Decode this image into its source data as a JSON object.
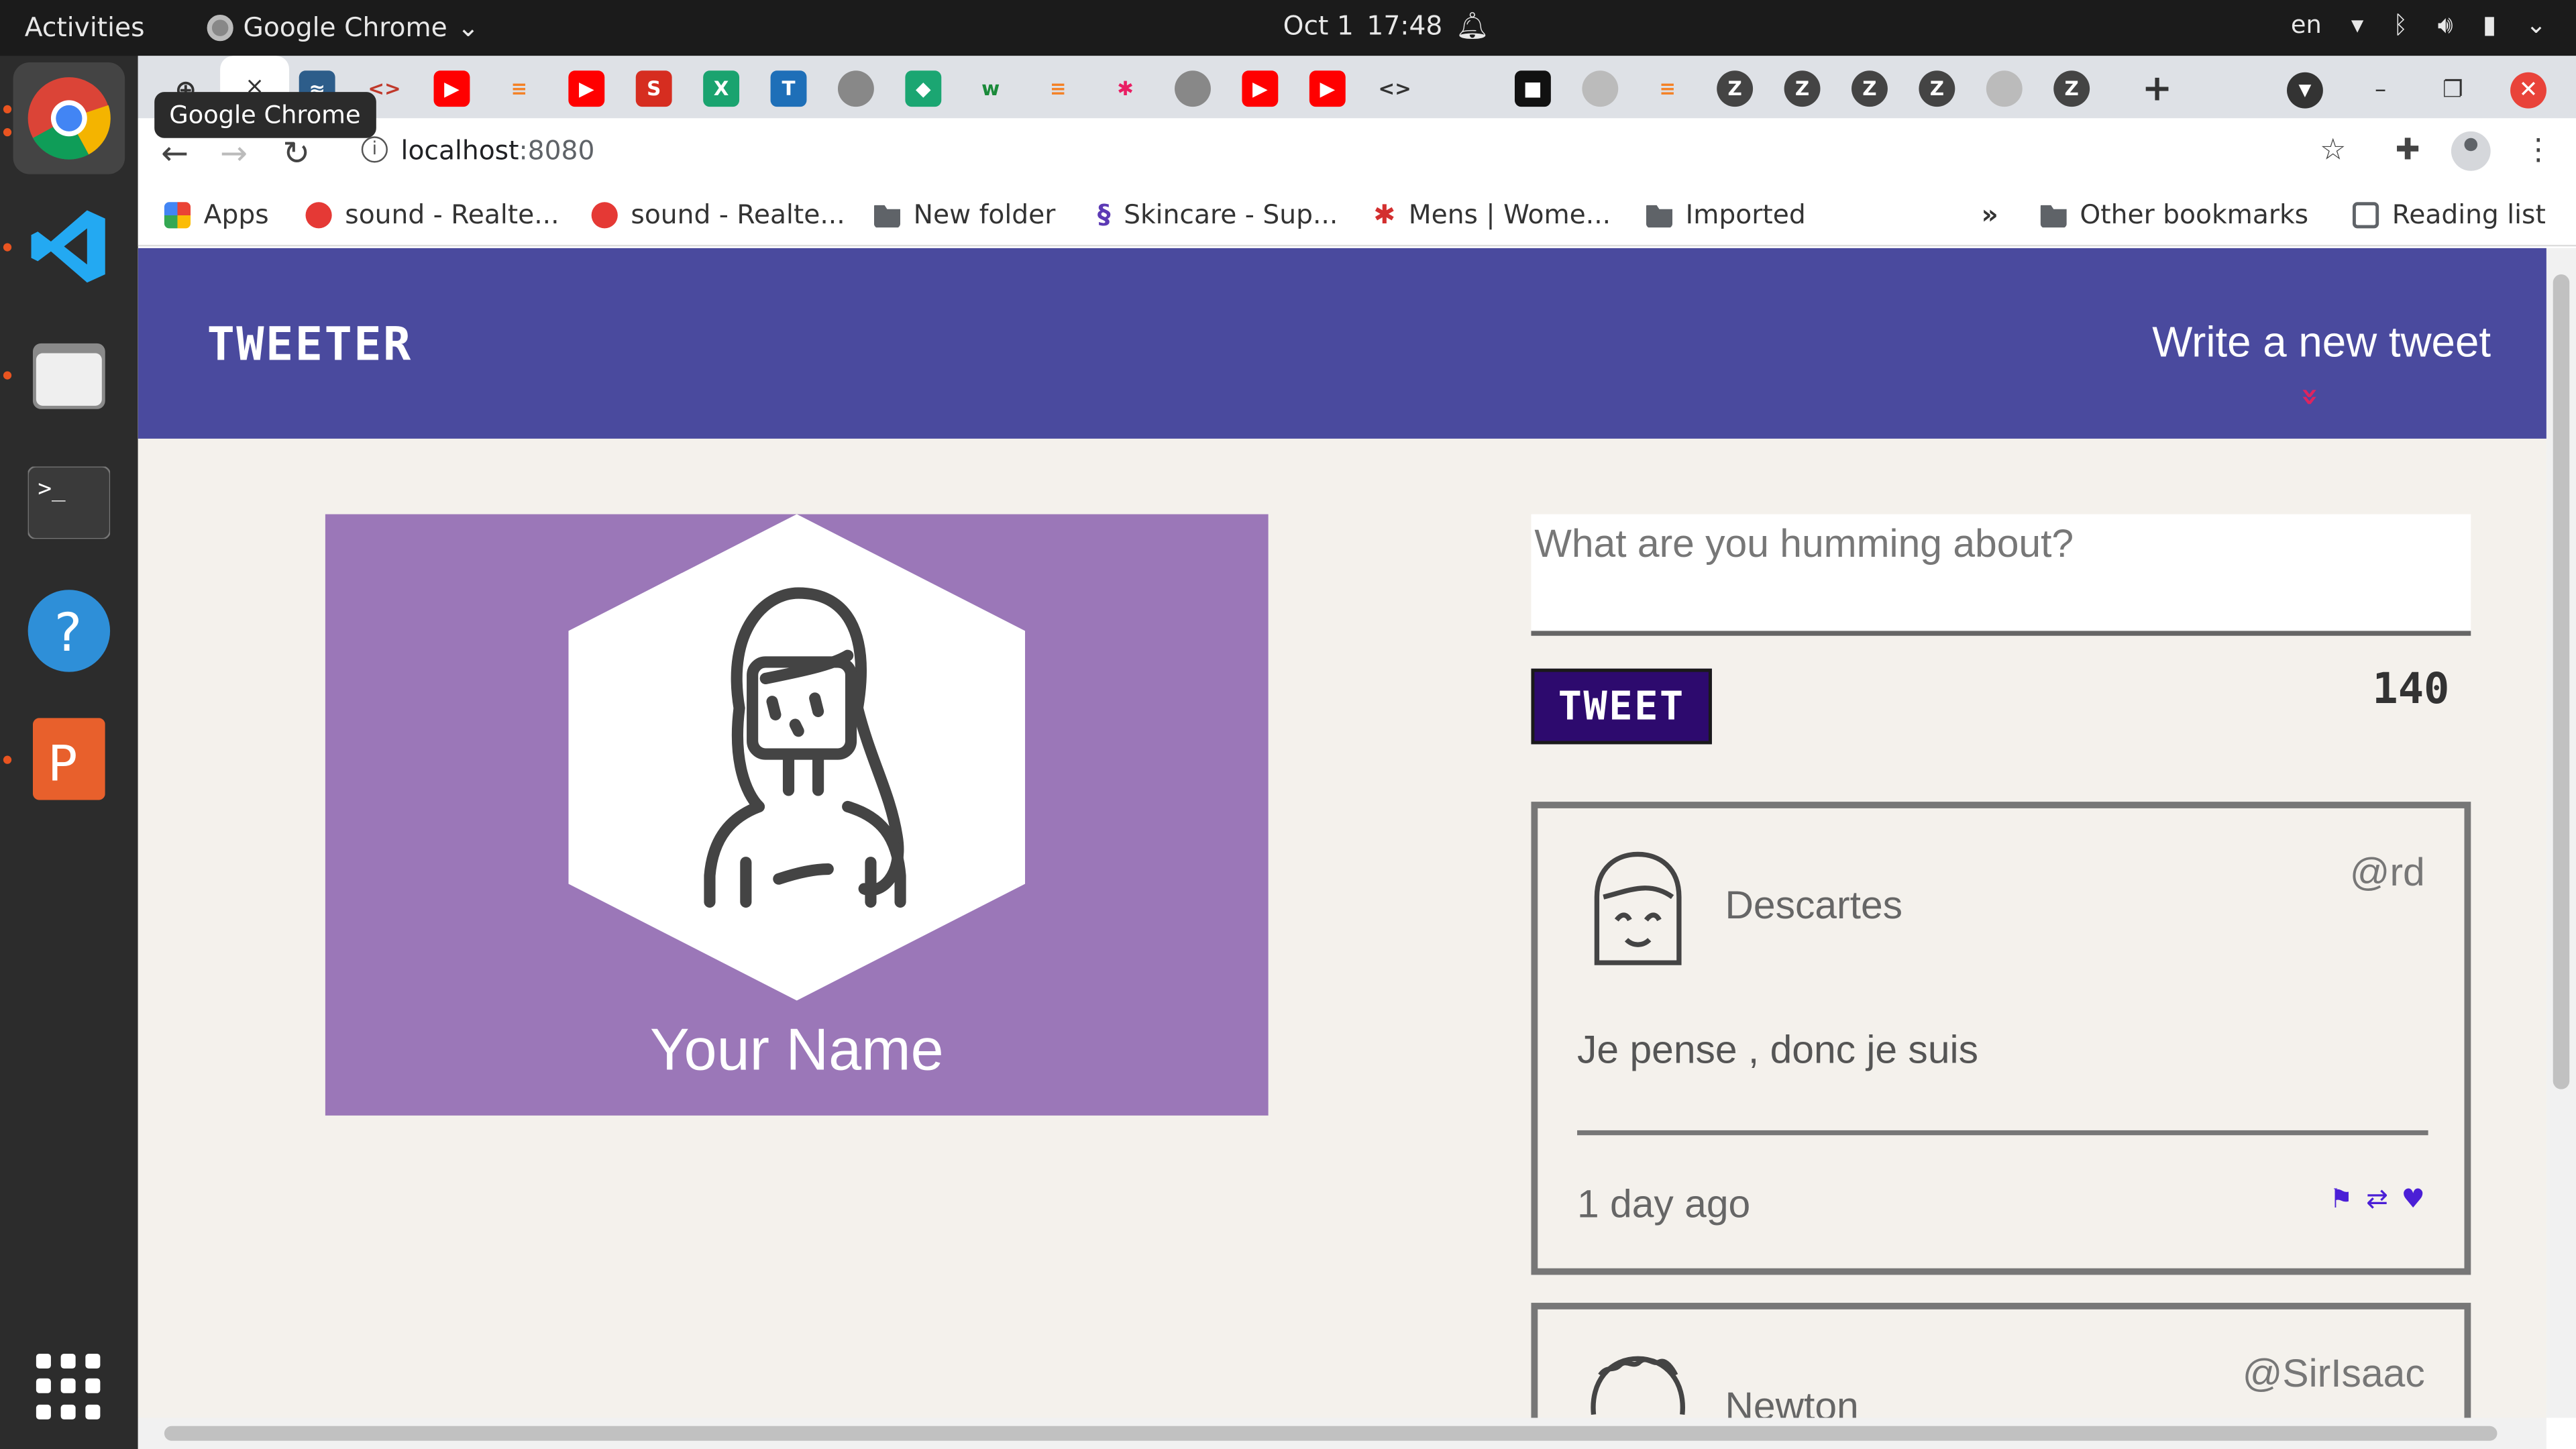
{
  "system": {
    "activities": "Activities",
    "app_name": "Google Chrome",
    "date": "Oct 1",
    "time": "17:48",
    "language": "en"
  },
  "browser": {
    "tooltip": "Google Chrome",
    "active_tab_close": "×",
    "url_host": "localhost",
    "url_port": ":8080",
    "bookmarks": [
      {
        "label": "Apps",
        "icon": "apps-grid-icon"
      },
      {
        "label": "sound - Realte...",
        "icon": "ask-icon"
      },
      {
        "label": "sound - Realte...",
        "icon": "ask-icon"
      },
      {
        "label": "New folder",
        "icon": "folder-icon"
      },
      {
        "label": "Skincare - Sup...",
        "icon": "skincare-icon"
      },
      {
        "label": "Mens | Wome...",
        "icon": "maple-leaf-icon"
      },
      {
        "label": "Imported",
        "icon": "folder-icon"
      }
    ],
    "bookmarks_overflow": "»",
    "other_bookmarks": "Other bookmarks",
    "reading_list": "Reading list"
  },
  "app": {
    "brand": "TWEETER",
    "compose_link": "Write a new tweet",
    "compose_arrow": "»",
    "profile_name": "Your Name",
    "textarea_placeholder": "What are you humming about?",
    "tweet_button": "TWEET",
    "char_counter": "140"
  },
  "tweets": [
    {
      "name": "Descartes",
      "handle": "@rd",
      "text": "Je pense , donc je suis",
      "time": "1 day ago"
    },
    {
      "name": "Newton",
      "handle": "@SirIsaac"
    }
  ],
  "colors": {
    "navbar": "#4a4a9e",
    "profile_bg": "#9b77b8",
    "tweet_button": "#2d0a6e",
    "action_icons": "#4b1fd6",
    "page_bg": "#f4f1ec"
  }
}
